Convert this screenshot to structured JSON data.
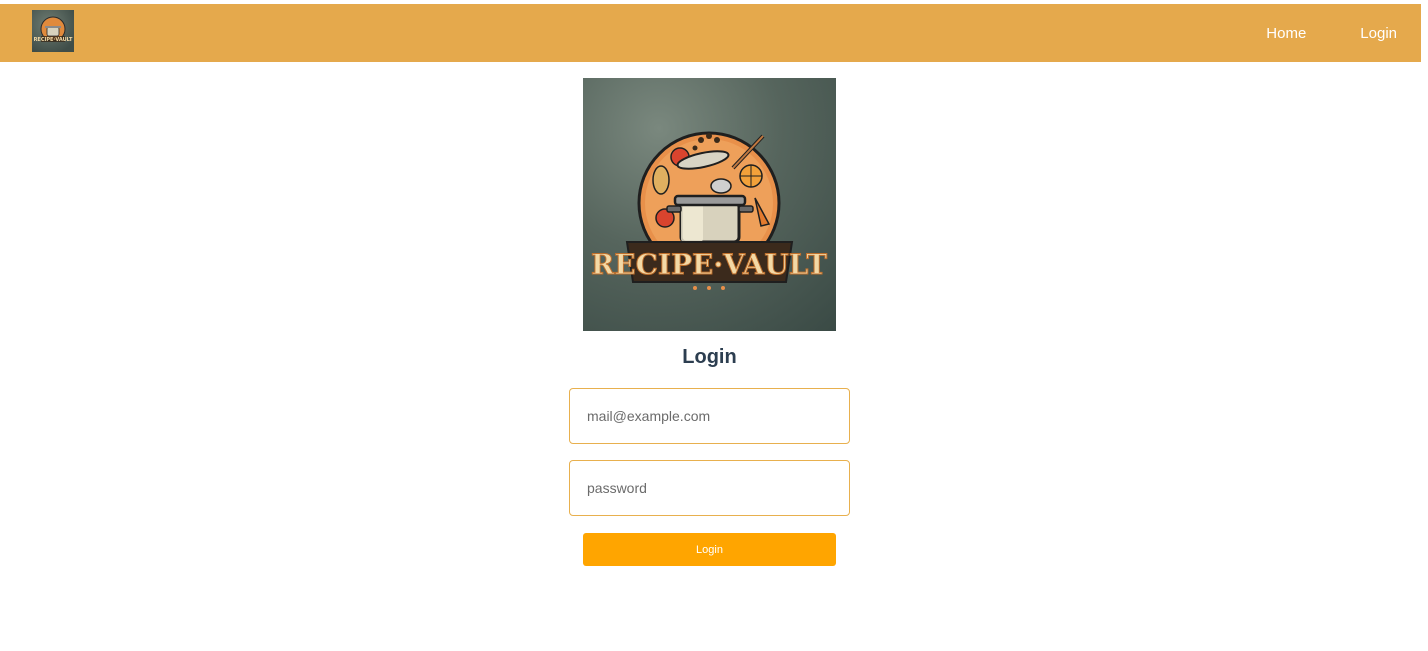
{
  "navbar": {
    "logo_icon": "recipe-vault-logo",
    "links": [
      {
        "label": "Home"
      },
      {
        "label": "Login"
      }
    ],
    "background": "#e5a94c"
  },
  "hero": {
    "logo_text": "RECIPE·VAULT",
    "logo_icon": "cooking-pot-logo"
  },
  "login": {
    "title": "Login",
    "email_placeholder": "mail@example.com",
    "password_placeholder": "password",
    "submit_label": "Login",
    "accent_color": "#ffa500",
    "input_border_color": "#e8b04e"
  }
}
